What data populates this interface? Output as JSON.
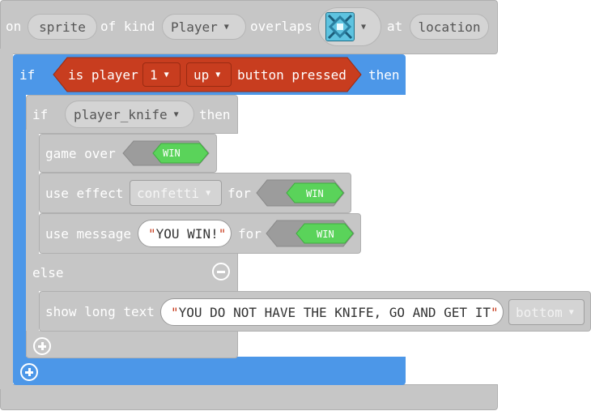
{
  "event": {
    "on": "on",
    "sprite_var": "sprite",
    "of_kind": "of kind",
    "kind": "Player",
    "overlaps": "overlaps",
    "tile_icon": "ice-tile-icon",
    "at": "at",
    "location_var": "location"
  },
  "outer_if": {
    "if_label": "if",
    "is_player": "is player",
    "player_num": "1",
    "button": "up",
    "button_pressed": "button pressed",
    "then_label": "then"
  },
  "inner_if": {
    "if_label": "if",
    "condition_var": "player_knife",
    "then_label": "then",
    "game_over": {
      "label": "game over",
      "value": "WIN"
    },
    "use_effect": {
      "label": "use effect",
      "effect": "confetti",
      "for": "for",
      "value": "WIN"
    },
    "use_message": {
      "label": "use message",
      "message": "YOU WIN!",
      "for": "for",
      "value": "WIN"
    },
    "else_label": "else",
    "show_long_text": {
      "label": "show long text",
      "text": "YOU DO NOT HAVE THE KNIFE, GO AND GET IT",
      "position": "bottom"
    }
  },
  "colors": {
    "event_block": "#c6c6c6",
    "if_blue": "#4c97e8",
    "sensor_red": "#c83d1f",
    "win_green": "#5ad35a"
  }
}
